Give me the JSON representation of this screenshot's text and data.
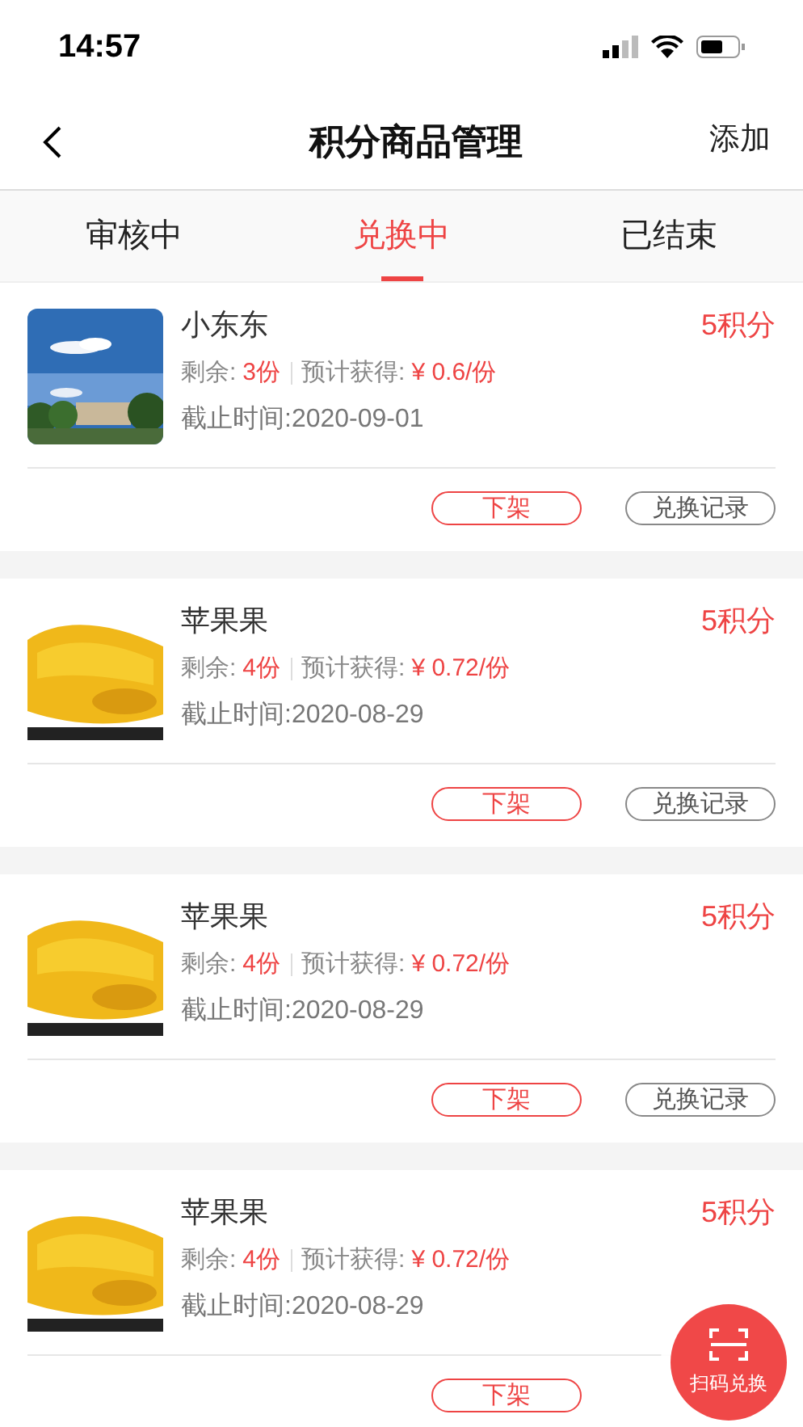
{
  "status_bar": {
    "time": "14:57"
  },
  "nav": {
    "title": "积分商品管理",
    "action": "添加"
  },
  "tabs": [
    {
      "label": "审核中",
      "selected": false
    },
    {
      "label": "兑换中",
      "selected": true
    },
    {
      "label": "已结束",
      "selected": false
    }
  ],
  "items": [
    {
      "name": "小东东",
      "points": "5积分",
      "remain_label": "剩余:",
      "remain": "3份",
      "expect_label": "预计获得:",
      "expect": "¥ 0.6/份",
      "deadline": "截止时间:2020-09-01",
      "delist": "下架",
      "record": "兑换记录"
    },
    {
      "name": "苹果果",
      "points": "5积分",
      "remain_label": "剩余:",
      "remain": "4份",
      "expect_label": "预计获得:",
      "expect": "¥ 0.72/份",
      "deadline": "截止时间:2020-08-29",
      "delist": "下架",
      "record": "兑换记录"
    },
    {
      "name": "苹果果",
      "points": "5积分",
      "remain_label": "剩余:",
      "remain": "4份",
      "expect_label": "预计获得:",
      "expect": "¥ 0.72/份",
      "deadline": "截止时间:2020-08-29",
      "delist": "下架",
      "record": "兑换记录"
    },
    {
      "name": "苹果果",
      "points": "5积分",
      "remain_label": "剩余:",
      "remain": "4份",
      "expect_label": "预计获得:",
      "expect": "¥ 0.72/份",
      "deadline": "截止时间:2020-08-29",
      "delist": "下架"
    }
  ],
  "fab": {
    "label": "扫码兑换"
  }
}
